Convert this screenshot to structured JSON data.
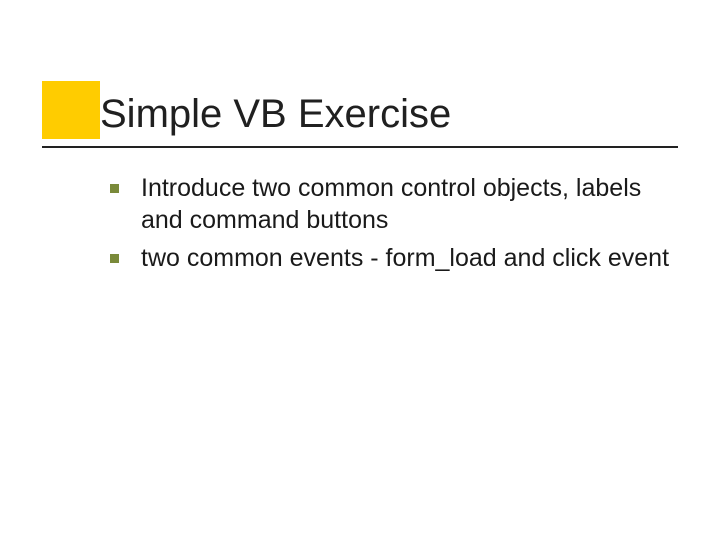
{
  "slide": {
    "title": "Simple VB Exercise",
    "bullets": [
      "Introduce two common control objects, labels and command buttons",
      "two common events - form_load and click event"
    ]
  }
}
